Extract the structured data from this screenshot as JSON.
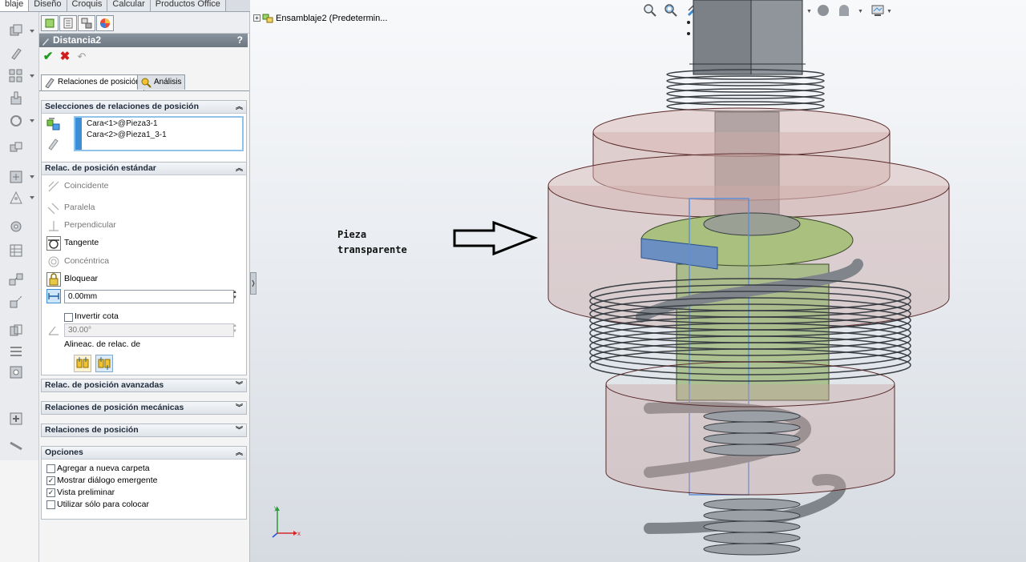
{
  "tabs": [
    {
      "label": "blaje",
      "active": true
    },
    {
      "label": "Diseño",
      "active": false
    },
    {
      "label": "Croquis",
      "active": false
    },
    {
      "label": "Calcular",
      "active": false
    },
    {
      "label": "Productos Office",
      "active": false
    }
  ],
  "property_manager": {
    "title": "Distancia2",
    "help": "?",
    "tabs": [
      {
        "label": "Relaciones de posición",
        "icon": "mate-icon",
        "active": true
      },
      {
        "label": "Análisis",
        "icon": "analysis-icon",
        "active": false
      }
    ],
    "selections": {
      "header": "Selecciones de relaciones de posición",
      "items": [
        "Cara<1>@Pieza3-1",
        "Cara<2>@Pieza1_3-1"
      ]
    },
    "standard": {
      "header": "Relac. de posición estándar",
      "mates": [
        {
          "label": "Coincidente",
          "icon": "coincident-icon",
          "enabled": false
        },
        {
          "label": "Paralela",
          "icon": "parallel-icon",
          "enabled": false
        },
        {
          "label": "Perpendicular",
          "icon": "perpendicular-icon",
          "enabled": false
        },
        {
          "label": "Tangente",
          "icon": "tangent-icon",
          "enabled": true
        },
        {
          "label": "Concéntrica",
          "icon": "concentric-icon",
          "enabled": false
        },
        {
          "label": "Bloquear",
          "icon": "lock-icon",
          "enabled": true
        }
      ],
      "distance_value": "0.00mm",
      "flip_dimension_label": "Invertir cota",
      "flip_dimension_checked": false,
      "angle_value": "30.00°",
      "alignment_label": "Alineac. de relac. de"
    },
    "advanced_header": "Relac. de posición avanzadas",
    "mechanical_header": "Relaciones de posición mecánicas",
    "mates_header": "Relaciones de posición",
    "options": {
      "header": "Opciones",
      "items": [
        {
          "label": "Agregar a nueva carpeta",
          "checked": false
        },
        {
          "label": "Mostrar diálogo emergente",
          "checked": true
        },
        {
          "label": "Vista preliminar",
          "checked": true
        },
        {
          "label": "Utilizar sólo para colocar",
          "checked": false
        }
      ]
    }
  },
  "viewport": {
    "tree_label": "Ensamblaje2  (Predetermin...",
    "annotation_line1": "Pieza",
    "annotation_line2": "transparente",
    "triad": {
      "x": "x",
      "y": "y"
    }
  },
  "colors": {
    "title_bar": "#6d7781",
    "selection_bar": "#3c8fd7",
    "transparent_part": "#c9a3a0",
    "green_part": "#9fb87a"
  }
}
